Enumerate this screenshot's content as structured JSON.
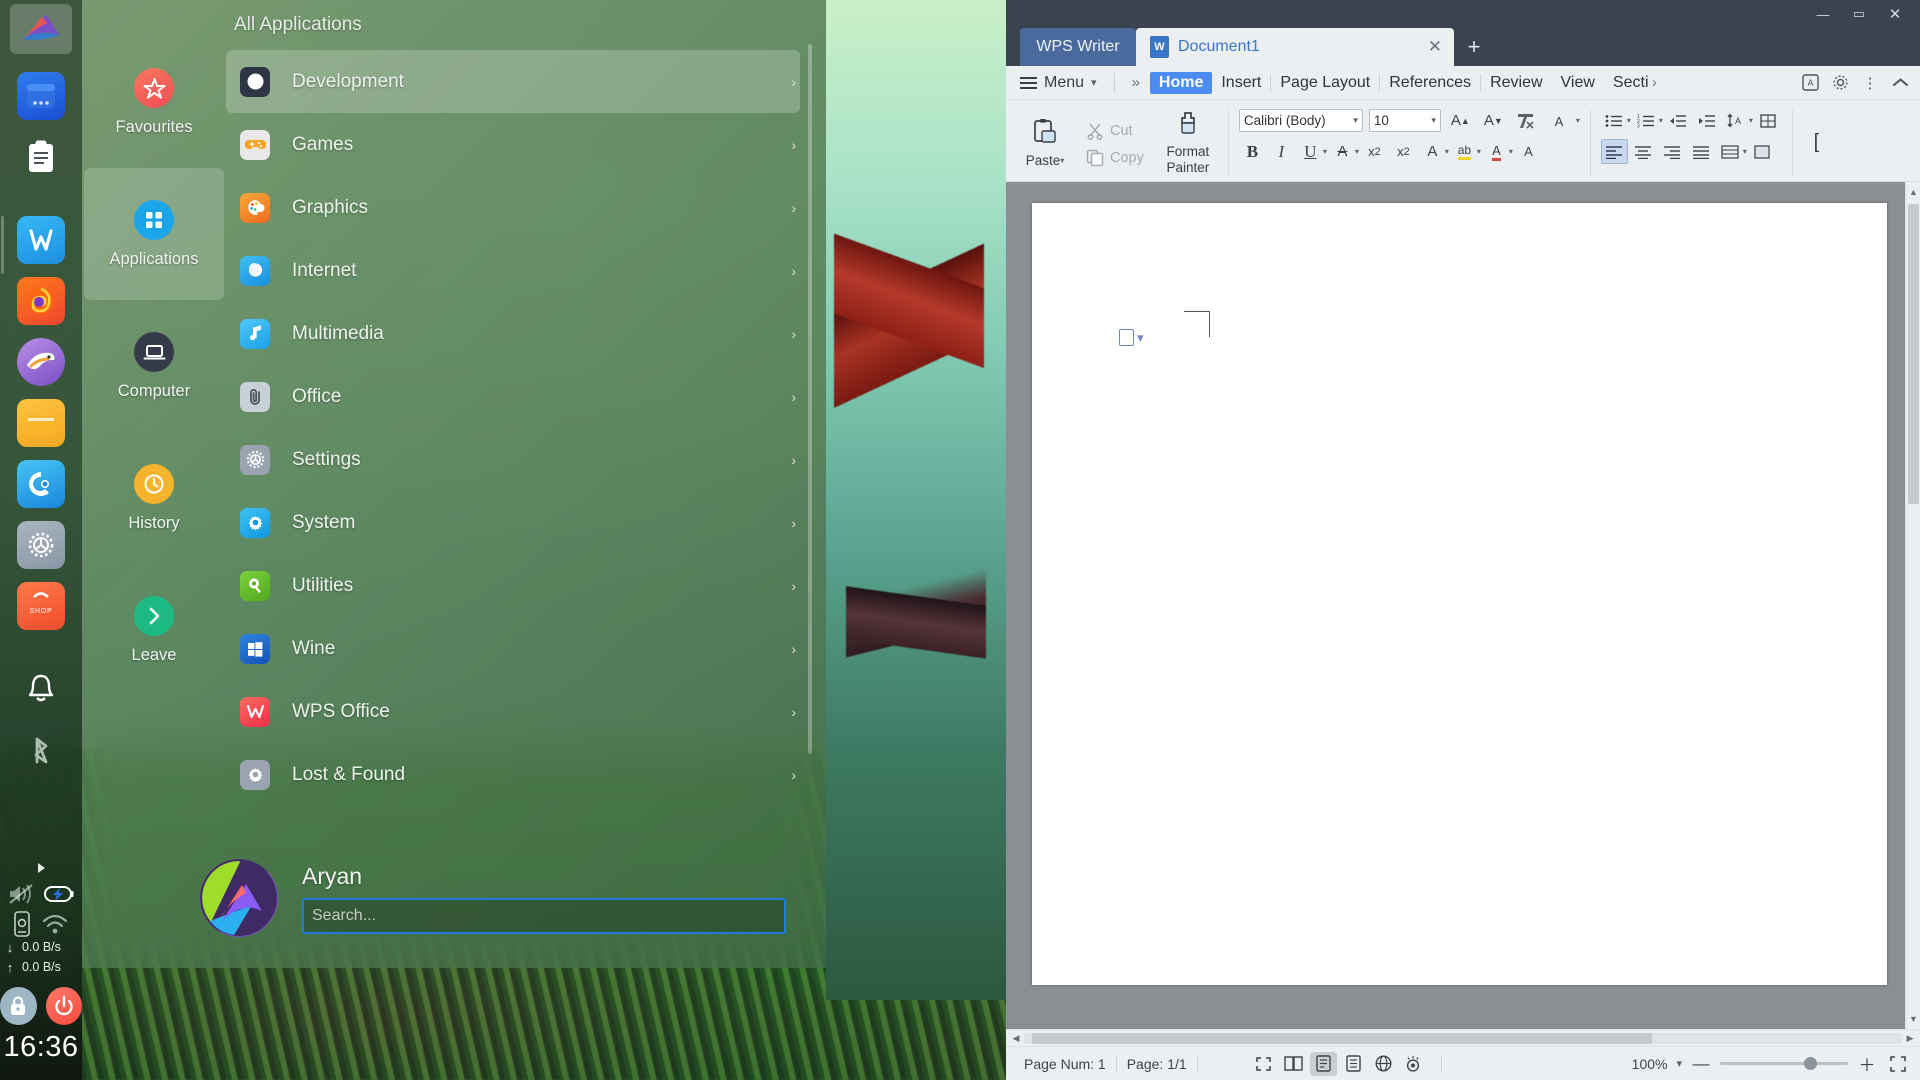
{
  "desktop": {
    "dock": {
      "top_logo": "endeavouros-logo-icon",
      "items": [
        {
          "name": "window-manager-icon",
          "label": "Window Manager"
        },
        {
          "name": "clipboard-icon",
          "label": "Clipboard"
        },
        {
          "name": "wps-writer-icon",
          "label": "WPS Writer"
        },
        {
          "name": "firefox-icon",
          "label": "Firefox"
        },
        {
          "name": "thunderbird-icon",
          "label": "Thunderbird"
        },
        {
          "name": "file-manager-icon",
          "label": "File Manager"
        },
        {
          "name": "calamares-icon",
          "label": "Installer"
        },
        {
          "name": "settings-gear-icon",
          "label": "Settings"
        },
        {
          "name": "software-shop-icon",
          "label": "Software Store"
        },
        {
          "name": "notification-bell-icon",
          "label": "Notifications"
        },
        {
          "name": "bluetooth-icon",
          "label": "Bluetooth"
        }
      ],
      "shop_icon_text": "SHOP",
      "tray": {
        "volume_icon": "volume-muted-icon",
        "battery_icon": "battery-charging-icon",
        "device_icon": "device-settings-icon",
        "wifi_icon": "wifi-icon",
        "expand_icon": "tray-expand-arrow-icon",
        "download_arrow": "↓",
        "upload_arrow": "↑",
        "download_speed": "0.0 B/s",
        "upload_speed": "0.0 B/s",
        "lock_icon": "lock-icon",
        "power_icon": "power-icon",
        "clock": "16:36"
      }
    },
    "menu": {
      "sidebar": [
        {
          "label": "Favourites",
          "icon": "star-icon",
          "selected": false,
          "color": "#f2564b"
        },
        {
          "label": "Applications",
          "icon": "grid-icon",
          "selected": true,
          "color": "#1ba5e8"
        },
        {
          "label": "Computer",
          "icon": "laptop-icon",
          "selected": false,
          "color": "#353b4a"
        },
        {
          "label": "History",
          "icon": "clock-icon",
          "selected": false,
          "color": "#f5b32e"
        },
        {
          "label": "Leave",
          "icon": "chevron-right-icon",
          "selected": false,
          "color": "#1dba84"
        }
      ],
      "header": "All Applications",
      "categories": [
        {
          "label": "Development",
          "icon": "compass-icon",
          "color": "#2e3646",
          "active": true
        },
        {
          "label": "Games",
          "icon": "gamepad-icon",
          "color": "#e8e8e8",
          "active": false
        },
        {
          "label": "Graphics",
          "icon": "palette-icon",
          "color": "#f2822e",
          "active": false
        },
        {
          "label": "Internet",
          "icon": "globe-icon",
          "color": "#22a7e8",
          "active": false
        },
        {
          "label": "Multimedia",
          "icon": "music-note-icon",
          "color": "#2eb4f0",
          "active": false
        },
        {
          "label": "Office",
          "icon": "paperclip-icon",
          "color": "#c9cfd6",
          "active": false
        },
        {
          "label": "Settings",
          "icon": "gear-wheel-icon",
          "color": "#9aa4b0",
          "active": false
        },
        {
          "label": "System",
          "icon": "cog-icon",
          "color": "#1eaceb",
          "active": false
        },
        {
          "label": "Utilities",
          "icon": "tools-icon",
          "color": "#62b92e",
          "active": false
        },
        {
          "label": "Wine",
          "icon": "windows-icon",
          "color": "#1f6fd0",
          "active": false
        },
        {
          "label": "WPS Office",
          "icon": "wps-icon",
          "color": "#f2454f",
          "active": false
        },
        {
          "label": "Lost & Found",
          "icon": "gear-icon",
          "color": "#9aa4b0",
          "active": false
        }
      ],
      "arrow_glyph": "›",
      "user": {
        "name": "Aryan",
        "avatar": "user-avatar",
        "search_placeholder": "Search...",
        "search_value": ""
      }
    }
  },
  "wps": {
    "window_controls": {
      "minimize": "—",
      "maximize": "▭",
      "close": "✕"
    },
    "tabs": {
      "app_tab": "WPS Writer",
      "doc_tab": "Document1",
      "doc_icon": "wps-writer-doc-icon",
      "close_glyph": "✕",
      "new_tab_glyph": "+"
    },
    "ribbon_tabs": {
      "menu_label": "Menu",
      "overflow_glyph": "»",
      "items": [
        {
          "label": "Home",
          "active": true
        },
        {
          "label": "Insert",
          "active": false
        },
        {
          "label": "Page Layout",
          "active": false
        },
        {
          "label": "References",
          "active": false
        },
        {
          "label": "Review",
          "active": false
        },
        {
          "label": "View",
          "active": false
        },
        {
          "label": "Section",
          "active": false
        }
      ],
      "scroll_right_glyph": "›",
      "right_icons": [
        {
          "name": "find-replace-icon",
          "glyph": "A̲"
        },
        {
          "name": "settings-gear-icon",
          "glyph": "⚙"
        },
        {
          "name": "more-vertical-icon",
          "glyph": "⋮"
        },
        {
          "name": "collapse-ribbon-icon",
          "glyph": "⌃"
        }
      ]
    },
    "ribbon": {
      "paste_label": "Paste",
      "cut_label": "Cut",
      "copy_label": "Copy",
      "format_painter_label": "Format\nPainter",
      "format_painter_line1": "Format",
      "format_painter_line2": "Painter",
      "font_name": "Calibri (Body)",
      "font_size": "10",
      "buttons": [
        {
          "name": "grow-font-button",
          "glyph": "A⁺"
        },
        {
          "name": "shrink-font-button",
          "glyph": "A⁻"
        },
        {
          "name": "clear-formatting-button",
          "glyph": "⌫"
        },
        {
          "name": "asian-layout-button",
          "glyph": "文"
        },
        {
          "name": "bold-button",
          "glyph": "B"
        },
        {
          "name": "italic-button",
          "glyph": "I"
        },
        {
          "name": "underline-button",
          "glyph": "U"
        },
        {
          "name": "strikethrough-button",
          "glyph": "A"
        },
        {
          "name": "superscript-button",
          "glyph": "x²"
        },
        {
          "name": "subscript-button",
          "glyph": "x₂"
        },
        {
          "name": "text-effects-button",
          "glyph": "A"
        },
        {
          "name": "highlight-color-button",
          "glyph": "ab"
        },
        {
          "name": "font-color-button",
          "glyph": "A"
        },
        {
          "name": "character-border-button",
          "glyph": "A"
        },
        {
          "name": "bullets-button",
          "glyph": "≔"
        },
        {
          "name": "numbering-button",
          "glyph": "≕"
        },
        {
          "name": "decrease-indent-button",
          "glyph": "⇤"
        },
        {
          "name": "increase-indent-button",
          "glyph": "⇥"
        },
        {
          "name": "line-spacing-button",
          "glyph": "↕A"
        },
        {
          "name": "borders-button",
          "glyph": "▦"
        },
        {
          "name": "align-left-button",
          "glyph": "≡"
        },
        {
          "name": "align-center-button",
          "glyph": "≡"
        },
        {
          "name": "align-right-button",
          "glyph": "≡"
        },
        {
          "name": "justify-button",
          "glyph": "≡"
        },
        {
          "name": "distribute-button",
          "glyph": "▤"
        },
        {
          "name": "shading-button",
          "glyph": "▨"
        }
      ]
    },
    "document": {
      "layout_chip": "document-layout-options-icon"
    },
    "statusbar": {
      "page_num_label": "Page Num: 1",
      "page_label": "Page: 1/1",
      "view_icons": [
        {
          "name": "fullscreen-view-icon",
          "glyph": "⤢",
          "active": false
        },
        {
          "name": "reading-layout-icon",
          "glyph": "▯▯",
          "active": false
        },
        {
          "name": "print-layout-icon",
          "glyph": "▤",
          "active": true
        },
        {
          "name": "outline-view-icon",
          "glyph": "▥",
          "active": false
        },
        {
          "name": "web-layout-icon",
          "glyph": "⊕",
          "active": false
        },
        {
          "name": "eye-protection-icon",
          "glyph": "◎",
          "active": false
        }
      ],
      "zoom_value": "100%",
      "zoom_caret": "▾",
      "zoom_minus": "—",
      "zoom_plus": "＋",
      "fullscreen_icon": "expand-icon"
    }
  }
}
